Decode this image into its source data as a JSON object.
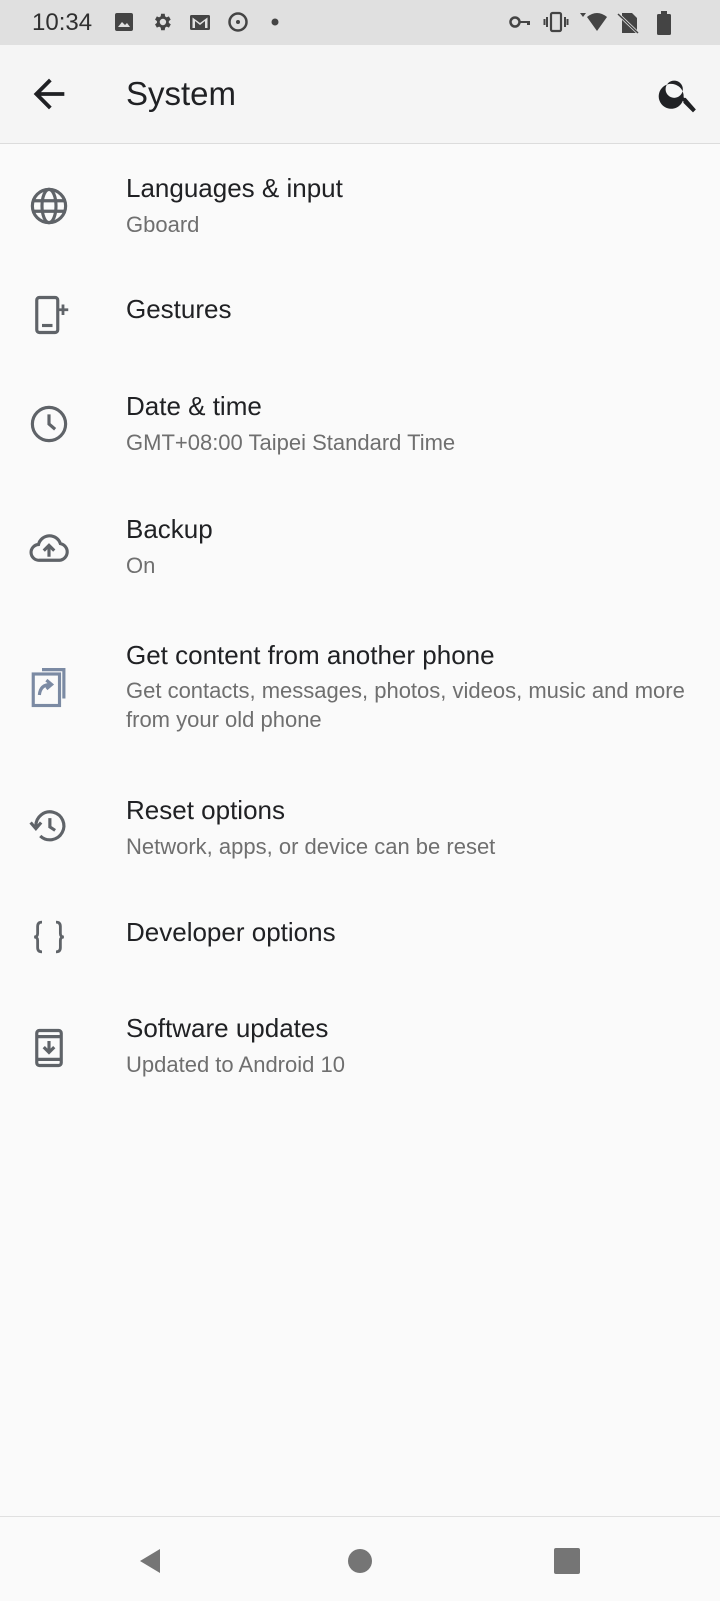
{
  "status_bar": {
    "time": "10:34",
    "left_icons": [
      "photos-notification-icon",
      "gear-icon",
      "gmail-icon",
      "sync-icon",
      "dot-icon"
    ],
    "right_icons": [
      "vpn-key-icon",
      "vibrate-icon",
      "wifi-icon",
      "no-sim-icon",
      "battery-icon"
    ]
  },
  "app_bar": {
    "title": "System",
    "back_icon": "arrow-back-icon",
    "search_icon": "search-icon"
  },
  "items": [
    {
      "icon": "globe-icon",
      "title": "Languages & input",
      "subtitle": "Gboard"
    },
    {
      "icon": "gestures-phone-icon",
      "title": "Gestures",
      "subtitle": ""
    },
    {
      "icon": "clock-icon",
      "title": "Date & time",
      "subtitle": "GMT+08:00 Taipei Standard Time"
    },
    {
      "icon": "cloud-upload-icon",
      "title": "Backup",
      "subtitle": "On"
    },
    {
      "icon": "transfer-phone-icon",
      "title": "Get content from another phone",
      "subtitle": "Get contacts, messages, photos, videos, music and more from your old phone"
    },
    {
      "icon": "history-icon",
      "title": "Reset options",
      "subtitle": "Network, apps, or device can be reset"
    },
    {
      "icon": "braces-icon",
      "title": "Developer options",
      "subtitle": ""
    },
    {
      "icon": "system-update-icon",
      "title": "Software updates",
      "subtitle": "Updated to Android 10"
    }
  ],
  "nav_bar": {
    "back": "nav-back-icon",
    "home": "nav-home-icon",
    "recents": "nav-recents-icon"
  },
  "colors": {
    "status_bar_bg": "#e0e0e0",
    "app_bar_bg": "#f5f5f5",
    "page_bg": "#fafafa",
    "icon_gray": "#5f6368",
    "transfer_icon_blue": "#7b8aa3"
  }
}
